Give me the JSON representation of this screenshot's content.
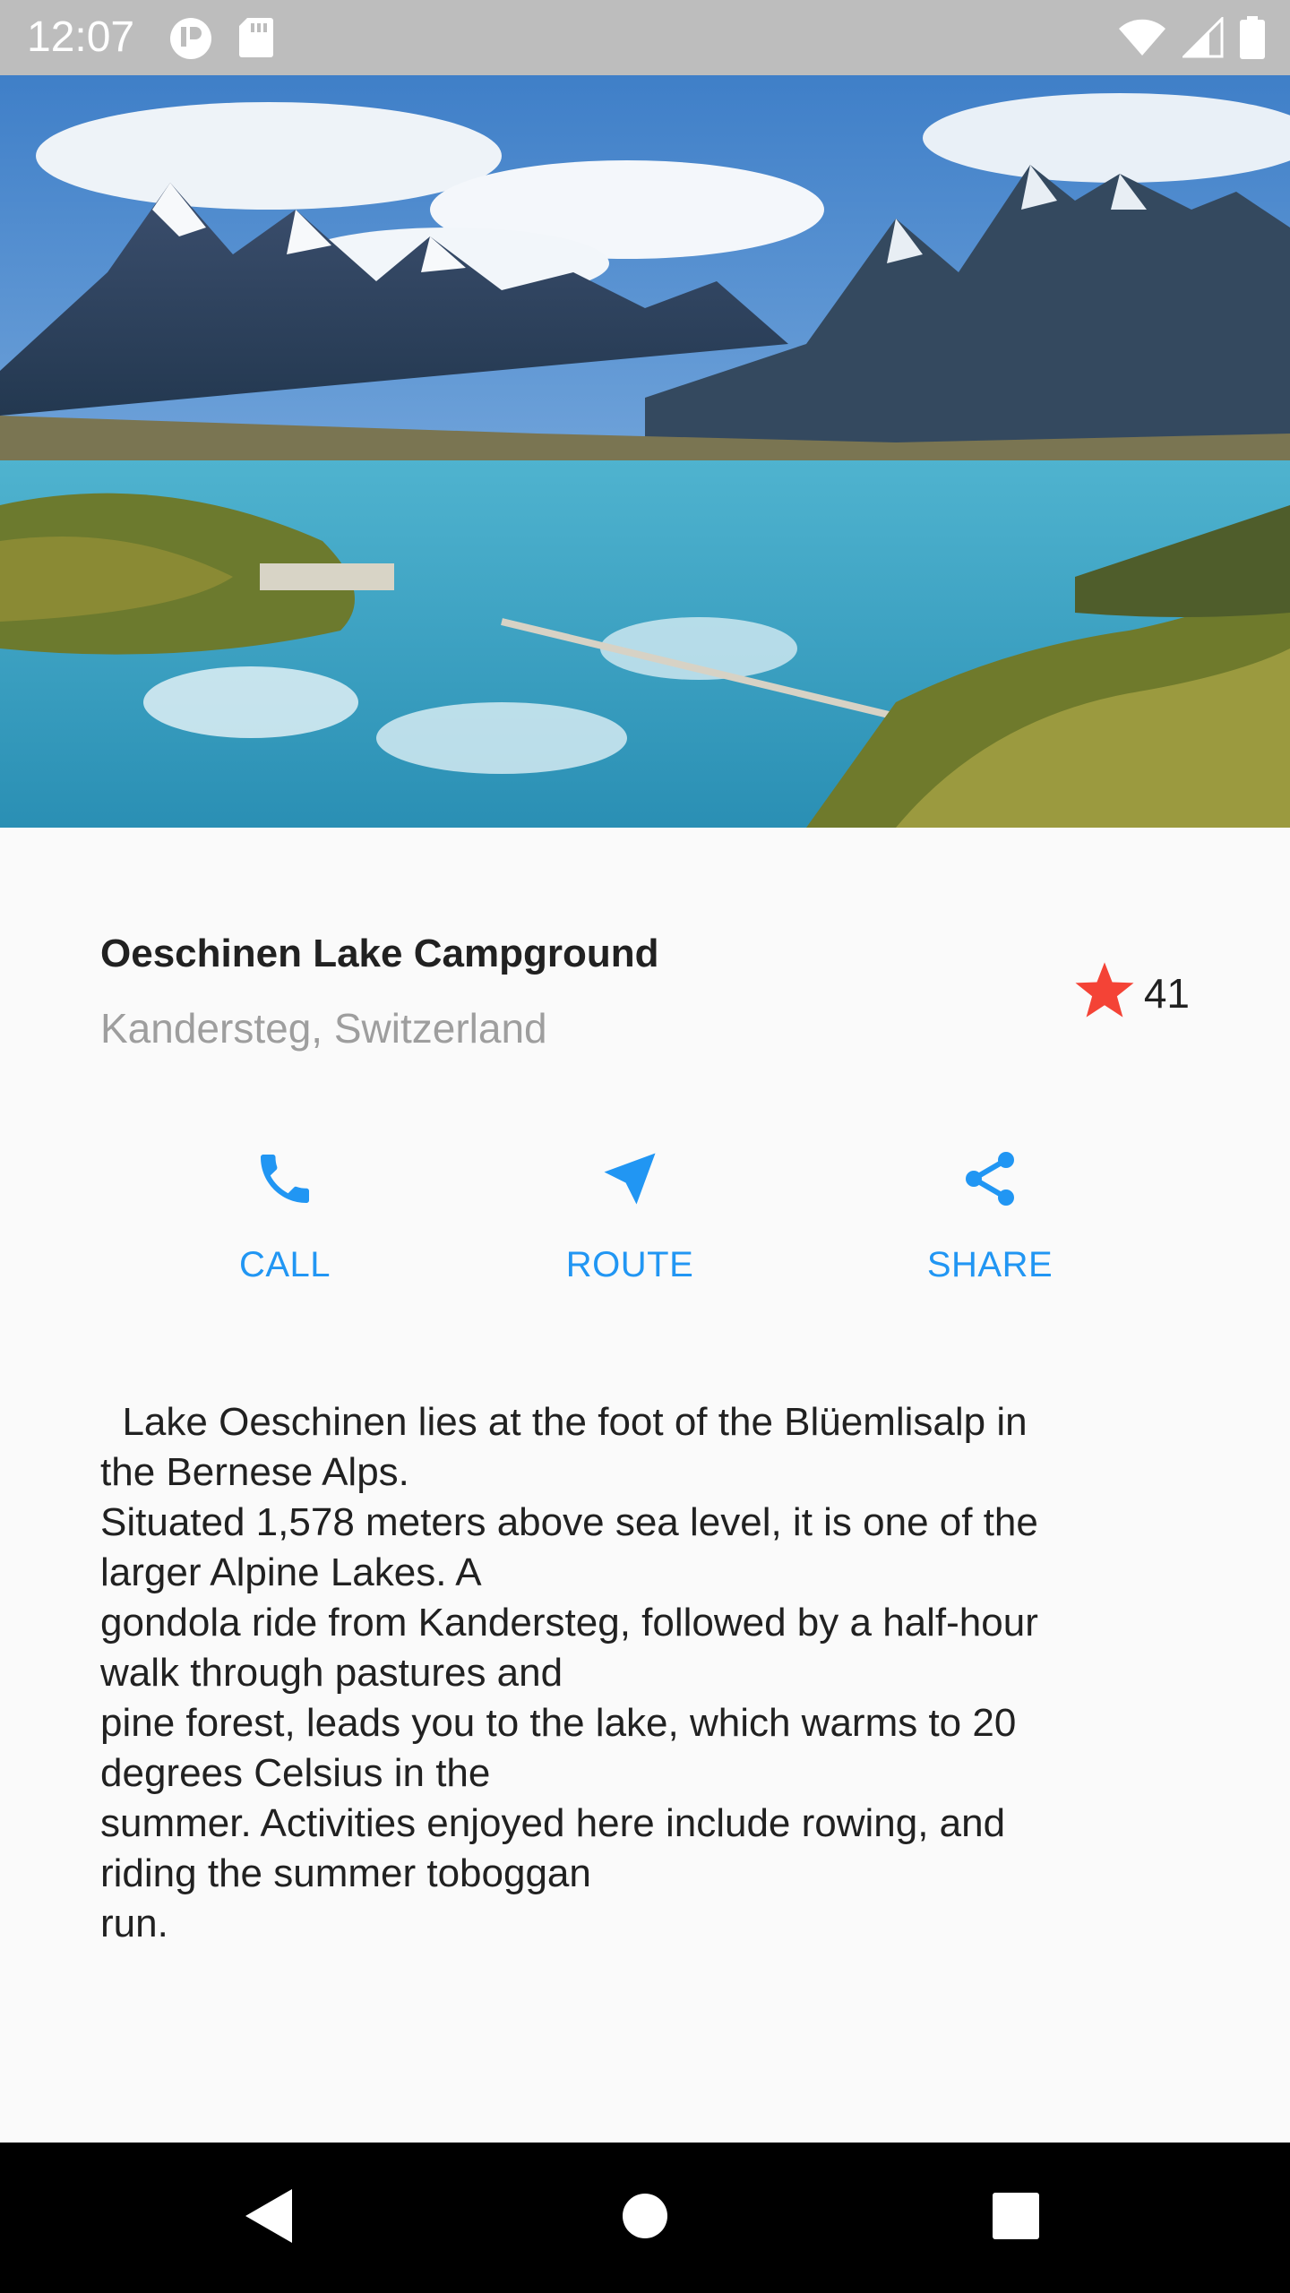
{
  "status_bar": {
    "time": "12:07",
    "left_icons": [
      "notification-icon",
      "sd-card-icon"
    ],
    "right_icons": [
      "wifi-icon",
      "cell-signal-icon",
      "battery-icon"
    ]
  },
  "hero_image": {
    "subject": "mountain-lake-photo"
  },
  "place": {
    "title": "Oeschinen Lake Campground",
    "subtitle": "Kandersteg, Switzerland",
    "star_icon": "star-icon",
    "star_color": "#f44336",
    "rating_count": "41"
  },
  "actions": [
    {
      "label": "CALL",
      "icon": "phone-icon"
    },
    {
      "label": "ROUTE",
      "icon": "navigation-icon"
    },
    {
      "label": "SHARE",
      "icon": "share-icon"
    }
  ],
  "accent_color": "#2196f3",
  "description": "  Lake Oeschinen lies at the foot of the Blüemlisalp in\nthe Bernese Alps.\nSituated 1,578 meters above sea level, it is one of the\nlarger Alpine Lakes. A\ngondola ride from Kandersteg, followed by a half-hour\nwalk through pastures and\npine forest, leads you to the lake, which warms to 20\ndegrees Celsius in the\nsummer. Activities enjoyed here include rowing, and\nriding the summer toboggan\nrun.",
  "nav_bar": {
    "buttons": [
      "back-icon",
      "home-icon",
      "recents-icon"
    ]
  }
}
